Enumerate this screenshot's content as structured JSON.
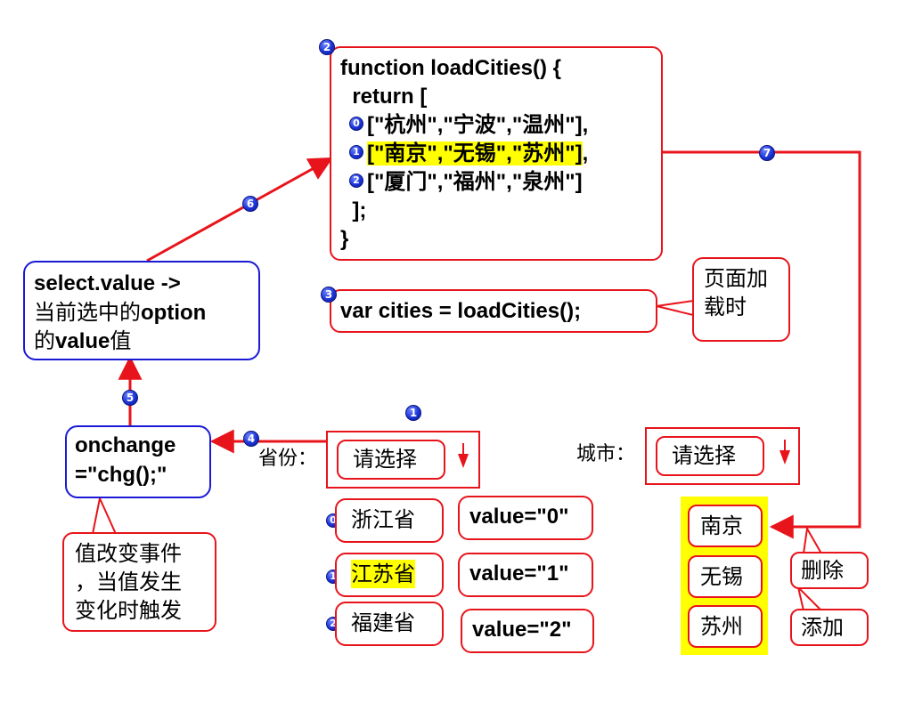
{
  "code_block": {
    "badge": "2",
    "line1": "function loadCities() {",
    "line2": "  return [",
    "rows": [
      {
        "badge": "0",
        "text": "[\"杭州\",\"宁波\",\"温州\"],"
      },
      {
        "badge": "1",
        "text_main": "[\"南京\",\"无锡\",\"苏州\"]",
        "text_tail": ","
      },
      {
        "badge": "2",
        "text": "[\"厦门\",\"福州\",\"泉州\"]"
      }
    ],
    "line6": "  ];",
    "line7": "}"
  },
  "call_block": {
    "badge": "3",
    "text": "var cities = loadCities();"
  },
  "page_load_note": {
    "text": "页面加\n载时"
  },
  "select_value_note": {
    "line1": "select.value ->",
    "line2_prefix": "当前选中的",
    "line2_bold": "option",
    "line3_prefix": "的",
    "line3_bold": "value",
    "line3_suffix": "值"
  },
  "onchange_box": {
    "line1": "onchange",
    "line2": "=\"chg();\""
  },
  "onchange_note": {
    "text": "值改变事件\n，当值发生\n变化时触发"
  },
  "province": {
    "label": "省份：",
    "badge": "1",
    "select_text": "请选择",
    "options": [
      {
        "badge": "0",
        "label": "浙江省",
        "value": "value=\"0\""
      },
      {
        "badge": "1",
        "label": "江苏省",
        "value": "value=\"1\""
      },
      {
        "badge": "2",
        "label": "福建省",
        "value": "value=\"2\""
      }
    ]
  },
  "city": {
    "label": "城市：",
    "select_text": "请选择",
    "options": [
      "南京",
      "无锡",
      "苏州"
    ]
  },
  "notes": {
    "delete": "删除",
    "add": "添加"
  },
  "step_badges": {
    "four": "4",
    "five": "5",
    "six": "6",
    "seven": "7"
  },
  "colors": {
    "red": "#e8141b",
    "blue": "#1a1ad6",
    "highlight": "#ffff00",
    "badge": "#1b33d6"
  }
}
